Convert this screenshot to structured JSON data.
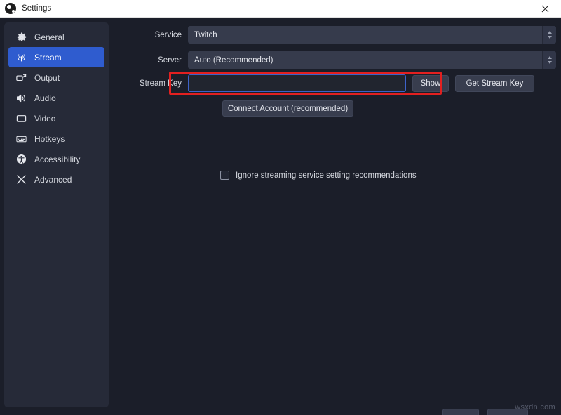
{
  "window": {
    "title": "Settings",
    "logo_icon": "obs-logo-icon",
    "close_icon": "close-icon"
  },
  "sidebar": {
    "items": [
      {
        "label": "General",
        "icon": "gear-icon",
        "selected": false
      },
      {
        "label": "Stream",
        "icon": "broadcast-icon",
        "selected": true
      },
      {
        "label": "Output",
        "icon": "output-screen-icon",
        "selected": false
      },
      {
        "label": "Audio",
        "icon": "speaker-icon",
        "selected": false
      },
      {
        "label": "Video",
        "icon": "monitor-icon",
        "selected": false
      },
      {
        "label": "Hotkeys",
        "icon": "keyboard-icon",
        "selected": false
      },
      {
        "label": "Accessibility",
        "icon": "accessibility-icon",
        "selected": false
      },
      {
        "label": "Advanced",
        "icon": "tools-icon",
        "selected": false
      }
    ]
  },
  "stream_settings": {
    "service": {
      "label": "Service",
      "value": "Twitch"
    },
    "server": {
      "label": "Server",
      "value": "Auto (Recommended)"
    },
    "stream_key": {
      "label": "Stream Key",
      "value": "",
      "placeholder": "",
      "show_button": "Show",
      "get_stream_key_button": "Get Stream Key"
    },
    "connect_account_button": "Connect Account (recommended)",
    "ignore_recommendations": {
      "label": "Ignore streaming service setting recommendations",
      "checked": false
    }
  },
  "annotation": {
    "color": "#e32020",
    "target": "stream-key-row"
  },
  "watermark": {
    "text": "wsxdn.com"
  },
  "colors": {
    "window_background": "#1b1e29",
    "sidebar_background": "#262a38",
    "selected_item": "#2f5ccf",
    "input_background": "#363b4c",
    "focus_border": "#3e63c9",
    "annotation_red": "#e32020"
  }
}
